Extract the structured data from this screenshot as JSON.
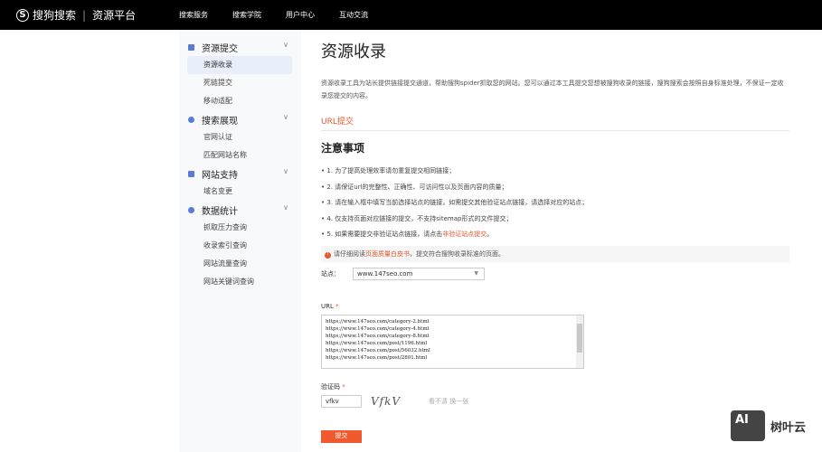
{
  "header": {
    "logo_brand": "搜狗搜索",
    "logo_product": "资源平台",
    "nav": [
      "搜索服务",
      "搜索学院",
      "用户中心",
      "互动交流"
    ]
  },
  "sidebar": {
    "groups": [
      {
        "label": "资源提交",
        "icon": "upload-icon",
        "items": [
          "资源收录",
          "死链提交",
          "移动适配"
        ]
      },
      {
        "label": "搜索展现",
        "icon": "display-icon",
        "items": [
          "官网认证",
          "匹配网站名称"
        ]
      },
      {
        "label": "网站支持",
        "icon": "support-icon",
        "items": [
          "域名变更"
        ]
      },
      {
        "label": "数据统计",
        "icon": "stats-icon",
        "items": [
          "抓取压力查询",
          "收录索引查询",
          "网站流量查询",
          "网站关键词查询"
        ]
      }
    ],
    "active": "资源收录"
  },
  "main": {
    "title": "资源收录",
    "description": "资源收录工具为站长提供链接提交通道，帮助搜狗spider抓取您的网站。您可以通过本工具提交您想被搜狗收录的链接，搜狗搜索会按照自身标准处理，不保证一定收录您提交的内容。",
    "tab": "URL提交",
    "notice_title": "注意事项",
    "notes": [
      "1. 为了提高处理效率请勿重复提交相同链接；",
      "2. 请保证url的完整性、正确性、可访问性以及页面内容的质量；",
      "3. 请在输入框中填写当前选择站点的链接，如需提交其他验证站点链接，请选择对应的站点；",
      "4. 仅支持页面对应链接的提交，不支持sitemap形式的文件提交；"
    ],
    "note5_prefix": "5. 如果需要提交非验证站点链接，请点击",
    "note5_link": "非验证站点提交",
    "note5_suffix": "。",
    "tip_prefix": "请仔细阅读",
    "tip_link": "页面质量白皮书",
    "tip_suffix": "，提交符合搜狗收录标准的页面。",
    "site_label": "站点：",
    "site_value": "www.147seo.com",
    "url_label": "URL",
    "urls": "https://www.147seo.com/category-2.html\nhttps://www.147seo.com/category-4.html\nhttps://www.147seo.com/category-8.html\nhttps://www.147seo.com/post/1196.html\nhttps://www.147seo.com/post/56032.html\nhttps://www.147seo.com/post/2801.html",
    "captcha_label": "验证码",
    "captcha_value": "vfkv",
    "captcha_image_text": "VfkV",
    "captcha_refresh": "看不清 换一张",
    "required_mark": "*",
    "submit": "提交"
  },
  "watermark": {
    "logo": "AI",
    "text": "树叶云"
  },
  "colors": {
    "accent": "#e4572e",
    "header_bg": "#000000",
    "submit_bg": "#f05a2e"
  }
}
